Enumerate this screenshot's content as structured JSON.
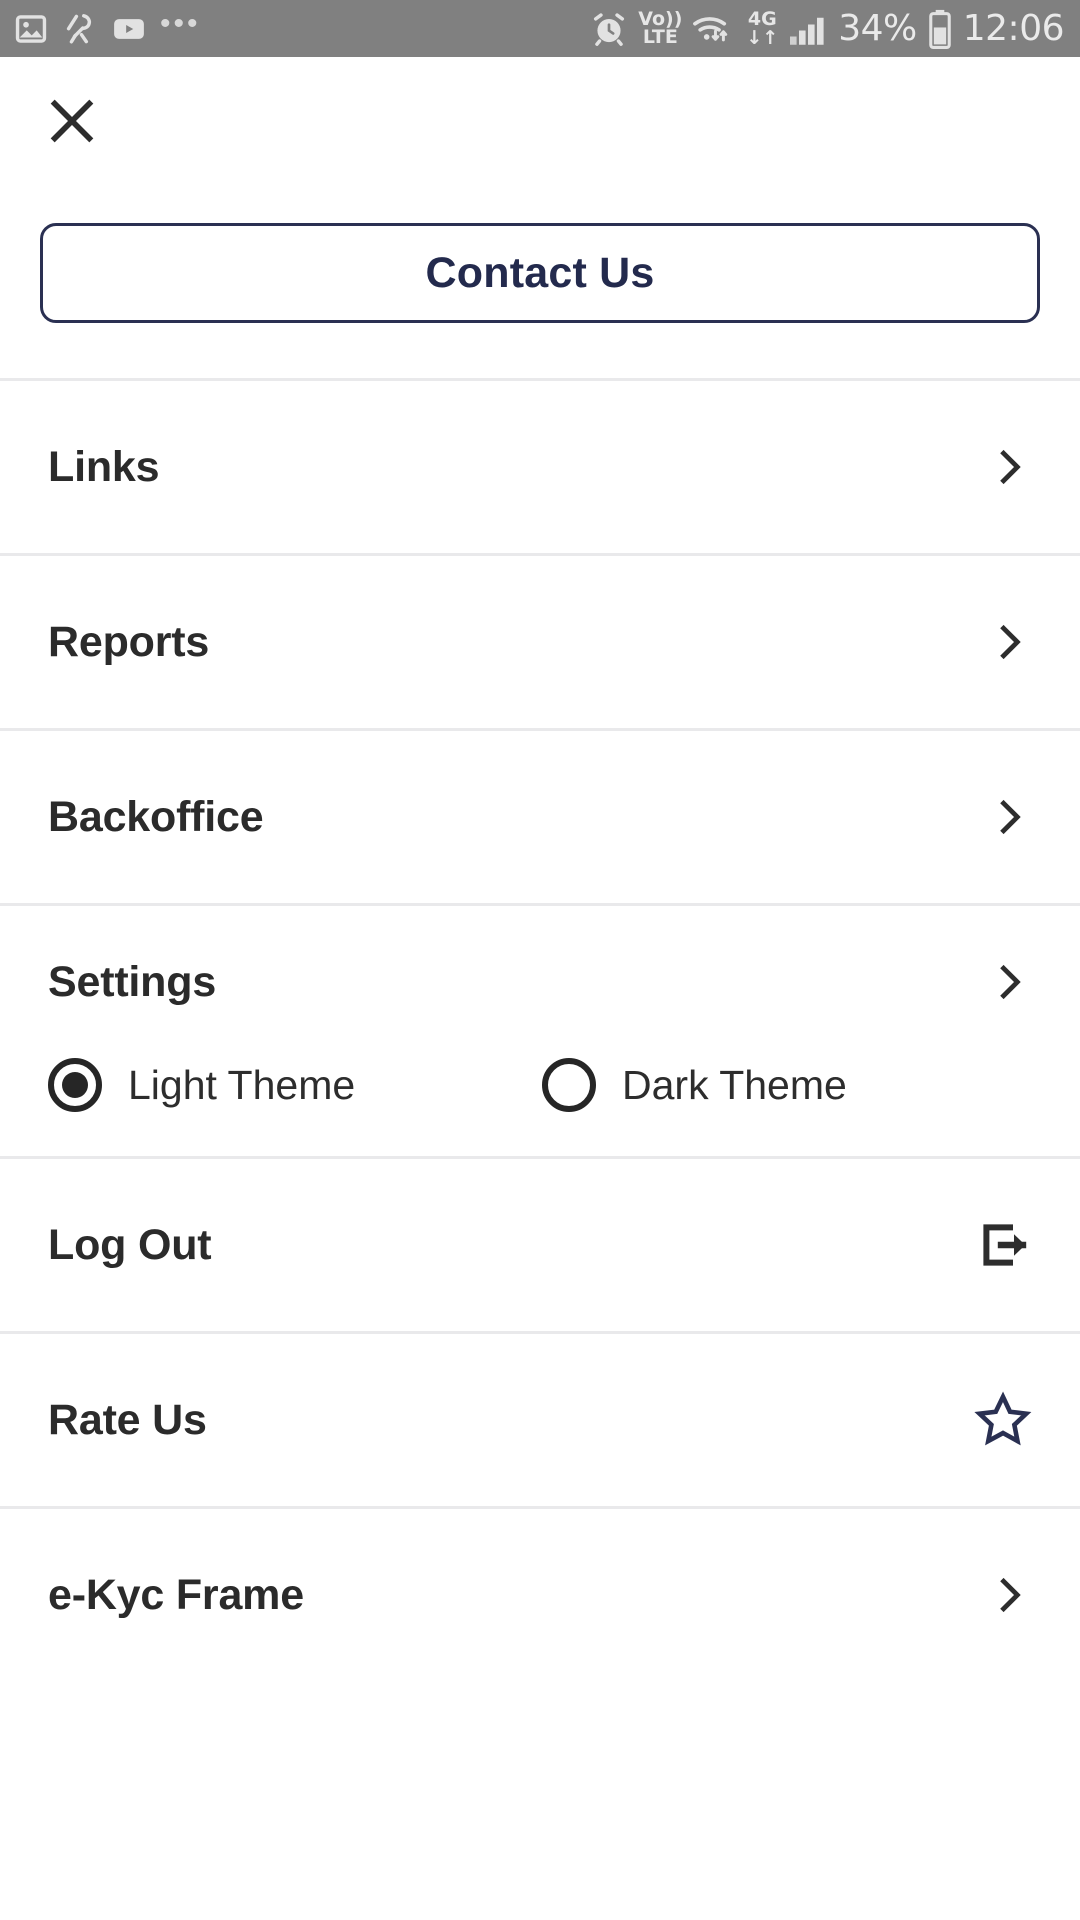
{
  "status_bar": {
    "background": "#808080",
    "left_icons": [
      {
        "name": "gallery-icon",
        "label": "gallery"
      },
      {
        "name": "fitness-icon",
        "label": "fitness"
      },
      {
        "name": "youtube-icon",
        "label": "youtube"
      },
      {
        "name": "more-notifications-icon",
        "label": "•••"
      }
    ],
    "right": {
      "alarm_icon": "alarm-icon",
      "volte_top": "Vo))",
      "volte_bottom": "LTE",
      "wifi_icon": "wifi-icon",
      "network_top": "4G",
      "network_bottom": "↓↑",
      "signal_icon": "signal-bars-icon",
      "battery_percent": "34%",
      "battery_icon": "battery-icon",
      "time": "12:06"
    }
  },
  "header": {
    "close_icon": "close-icon"
  },
  "contact": {
    "label": "Contact Us",
    "border_color": "#2a3052",
    "text_color": "#232a4d"
  },
  "menu": {
    "items": [
      {
        "label": "Links",
        "end_icon": "chevron-right-icon",
        "name": "links"
      },
      {
        "label": "Reports",
        "end_icon": "chevron-right-icon",
        "name": "reports"
      },
      {
        "label": "Backoffice",
        "end_icon": "chevron-right-icon",
        "name": "backoffice"
      }
    ],
    "settings": {
      "label": "Settings",
      "end_icon": "chevron-right-icon",
      "themes": [
        {
          "label": "Light Theme",
          "selected": true
        },
        {
          "label": "Dark Theme",
          "selected": false
        }
      ]
    },
    "logout": {
      "label": "Log Out",
      "end_icon": "logout-icon"
    },
    "rate_us": {
      "label": "Rate Us",
      "end_icon": "star-outline-icon",
      "icon_color": "#2a3052"
    },
    "ekyc": {
      "label": "e-Kyc Frame",
      "end_icon": "chevron-right-icon"
    }
  },
  "colors": {
    "accent_navy": "#2a3052",
    "text_dark": "#2b2b2b",
    "divider": "#e9e9eb"
  }
}
